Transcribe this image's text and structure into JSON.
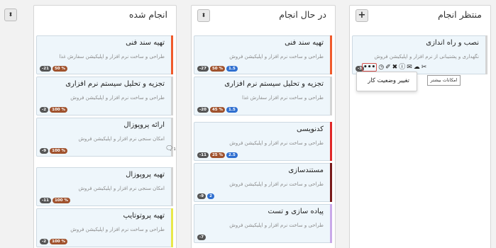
{
  "columns": [
    {
      "title": "منتظر انجام",
      "button": "+",
      "cards": [
        {
          "title": "نصب و راه اندازی",
          "subtitle": "نگهداری و پشتیبانی از نرم افزار و اپلیکیشن فروش",
          "day": "-3",
          "tooltip": "امکانات بیشتر",
          "menu_item": "تغییر وضعیت کار"
        }
      ]
    },
    {
      "title": "در حال انجام",
      "button": "⬍",
      "cards": [
        {
          "title": "تهیه سند فنی",
          "subtitle": "طراحی و ساخت نرم افزار و اپلیکیشن فروش",
          "color": "#f05a2b",
          "day": "-27",
          "percent": "50 %",
          "estimate": "1.5"
        },
        {
          "title": "تجزیه و تحلیل سیستم نرم افزاری",
          "subtitle": "طراحی و ساخت نرم افزار سفارش غذا",
          "color": "#d4d4d4",
          "day": "-20",
          "percent": "45 %",
          "estimate": "1.5"
        },
        {
          "title": "کدنویسی",
          "subtitle": "طراحی و ساخت نرم افزار و اپلیکیشن فروش",
          "color": "#e02727",
          "day": "-11",
          "percent": "25 %",
          "estimate": "2.5"
        },
        {
          "title": "مستندسازی",
          "subtitle": "طراحی و ساخت نرم افزار و اپلیکیشن فروش",
          "color": "#7a1a1a",
          "day": "-9",
          "estimate": "2"
        },
        {
          "title": "پیاده سازی و تست",
          "subtitle": "طراحی و ساخت نرم افزار و اپلیکیشن فروش",
          "color": "#c9a9e9",
          "day": "-7"
        }
      ]
    },
    {
      "title": "انجام شده",
      "button": "⬍",
      "cards": [
        {
          "title": "تهیه سند فنی",
          "subtitle": "طراحی و ساخت نرم افزار و اپلیکیشن سفارش غذا",
          "color": "#f05a2b",
          "day": "-21",
          "percent": "50 %"
        },
        {
          "title": "تجزیه و تحلیل سیستم نرم افزاری",
          "subtitle": "طراحی و ساخت نرم افزار و اپلیکیشن فروش",
          "color": "#d4d4d4",
          "day": "-2",
          "percent": "100 %"
        },
        {
          "title": "ارائه پروپوزال",
          "subtitle": "امکان سنجی نرم افزار و اپلیکیشن فروش",
          "color": "#d4d4d4",
          "day": "-9",
          "percent": "100 %",
          "comments": "1"
        },
        {
          "title": "تهیه پروپوزال",
          "subtitle": "امکان سنجی نرم افزار و اپلیکیشن فروش",
          "color": "#d4d4d4",
          "day": "-11",
          "percent": "100 %"
        },
        {
          "title": "تهیه پروتوتایپ",
          "subtitle": "طراحی و ساخت نرم افزار و اپلیکیشن فروش",
          "color": "#e8e84a",
          "day": "-2",
          "percent": "100 %"
        }
      ]
    }
  ]
}
